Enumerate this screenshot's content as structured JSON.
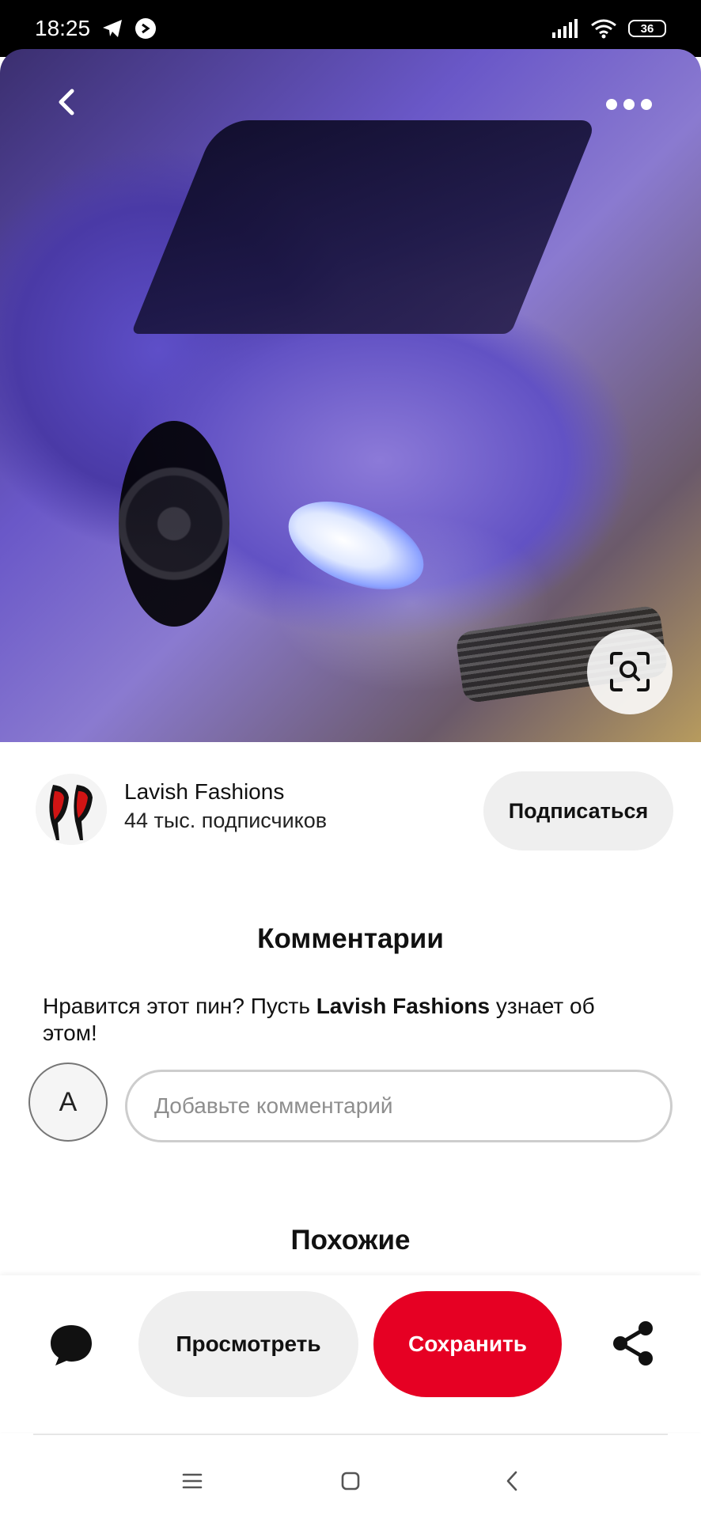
{
  "status_bar": {
    "time": "18:25",
    "battery": "36",
    "icons": [
      "telegram-icon",
      "shazam-icon",
      "signal-icon",
      "wifi-icon",
      "battery-icon"
    ]
  },
  "pin": {
    "image_icons": [
      "back-arrow-icon",
      "more-dots-icon",
      "visual-search-icon"
    ]
  },
  "creator": {
    "name": "Lavish Fashions",
    "followers": "44 тыс. подписчиков",
    "follow_label": "Подписаться"
  },
  "comments": {
    "title": "Комментарии",
    "prompt_before": "Нравится этот пин? Пусть ",
    "prompt_name": "Lavish Fashions",
    "prompt_after": " узнает об этом!",
    "user_initial": "A",
    "input_placeholder": "Добавьте комментарий",
    "input_value": ""
  },
  "similar": {
    "title": "Похожие"
  },
  "actions": {
    "view_label": "Просмотреть",
    "save_label": "Сохранить",
    "save_color": "#e60023"
  },
  "navbar": {
    "icons": [
      "menu-icon",
      "home-square-icon",
      "back-chevron-icon"
    ]
  }
}
